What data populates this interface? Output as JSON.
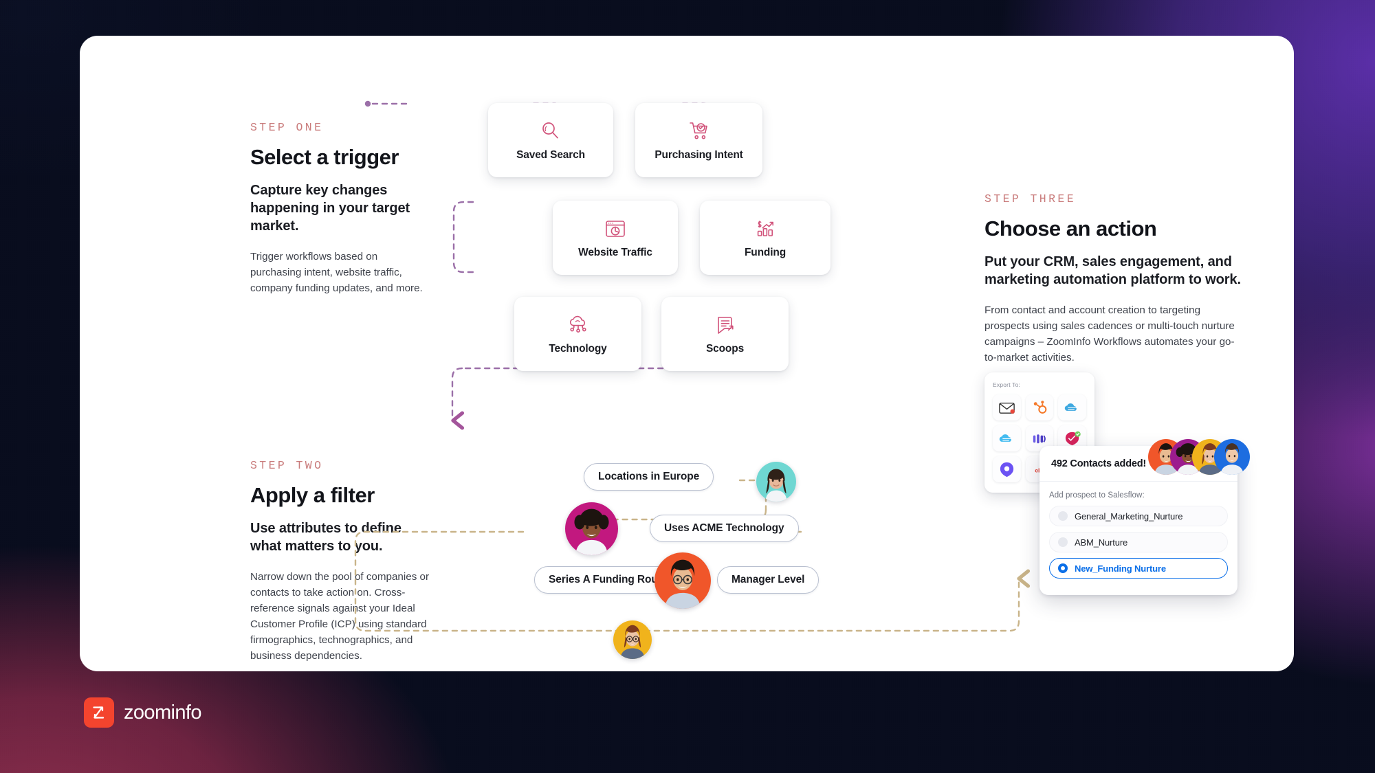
{
  "steps": {
    "one": {
      "kicker": "STEP ONE",
      "title": "Select a trigger",
      "subtitle": "Capture key changes happening in your target market.",
      "body": "Trigger workflows based on purchasing intent, website traffic, company funding updates, and more."
    },
    "two": {
      "kicker": "STEP TWO",
      "title": "Apply a filter",
      "subtitle": "Use attributes to define what matters to you.",
      "body": "Narrow down the pool of companies or contacts to take action on. Cross-reference signals against your Ideal Customer Profile (ICP) using standard firmographics, technographics, and business dependencies."
    },
    "three": {
      "kicker": "STEP THREE",
      "title": "Choose an action",
      "subtitle": "Put your CRM, sales engagement, and marketing automation platform to work.",
      "body": "From contact and account creation to targeting prospects using sales cadences or multi-touch nurture campaigns – ZoomInfo Workflows automates your go-to-market activities."
    }
  },
  "triggers": [
    {
      "label": "Saved Search",
      "icon": "magnifier-icon"
    },
    {
      "label": "Purchasing Intent",
      "icon": "shopping-cart-check-icon"
    },
    {
      "label": "Website Traffic",
      "icon": "browser-pie-chart-icon"
    },
    {
      "label": "Funding",
      "icon": "dollar-bar-growth-icon"
    },
    {
      "label": "Technology",
      "icon": "cloud-nodes-icon"
    },
    {
      "label": "Scoops",
      "icon": "speech-bubble-arrow-icon"
    }
  ],
  "filters": [
    {
      "label": "Locations in Europe"
    },
    {
      "label": "Uses ACME Technology"
    },
    {
      "label": "Series A Funding Round"
    },
    {
      "label": "Manager Level"
    }
  ],
  "avatars": [
    {
      "name": "avatar-teal",
      "bg": "#6fd7d2"
    },
    {
      "name": "avatar-magenta",
      "bg": "#c2187f"
    },
    {
      "name": "avatar-orange",
      "bg": "#f0562a"
    },
    {
      "name": "avatar-yellow",
      "bg": "#f0b31c"
    }
  ],
  "export_panel": {
    "title": "Export To:",
    "icons": [
      "email-icon",
      "hubspot-icon",
      "salesforce-icon",
      "salesforce-cloud-icon",
      "outreach-icon",
      "marketo-icon",
      "salesloft-icon",
      "eloqua-icon"
    ]
  },
  "contacts_card": {
    "headline": "492 Contacts added!",
    "salesflow_label": "Add prospect to Salesflow:",
    "options": [
      {
        "label": "General_Marketing_Nurture",
        "selected": false
      },
      {
        "label": "ABM_Nurture",
        "selected": false
      },
      {
        "label": "New_Funding Nurture",
        "selected": true
      }
    ],
    "stack_colors": [
      "#f0562a",
      "#9c1c8e",
      "#f0b31c",
      "#1d6de0"
    ]
  },
  "brand": {
    "logo_text": "zoominfo",
    "logo_mark": "zoominfo-z-mark",
    "accent": "#f4442e",
    "kicker_color": "#c97b7b",
    "wire_purple": "#9b6fa8",
    "wire_tan": "#c9b489",
    "selected_blue": "#0b6fe8"
  }
}
